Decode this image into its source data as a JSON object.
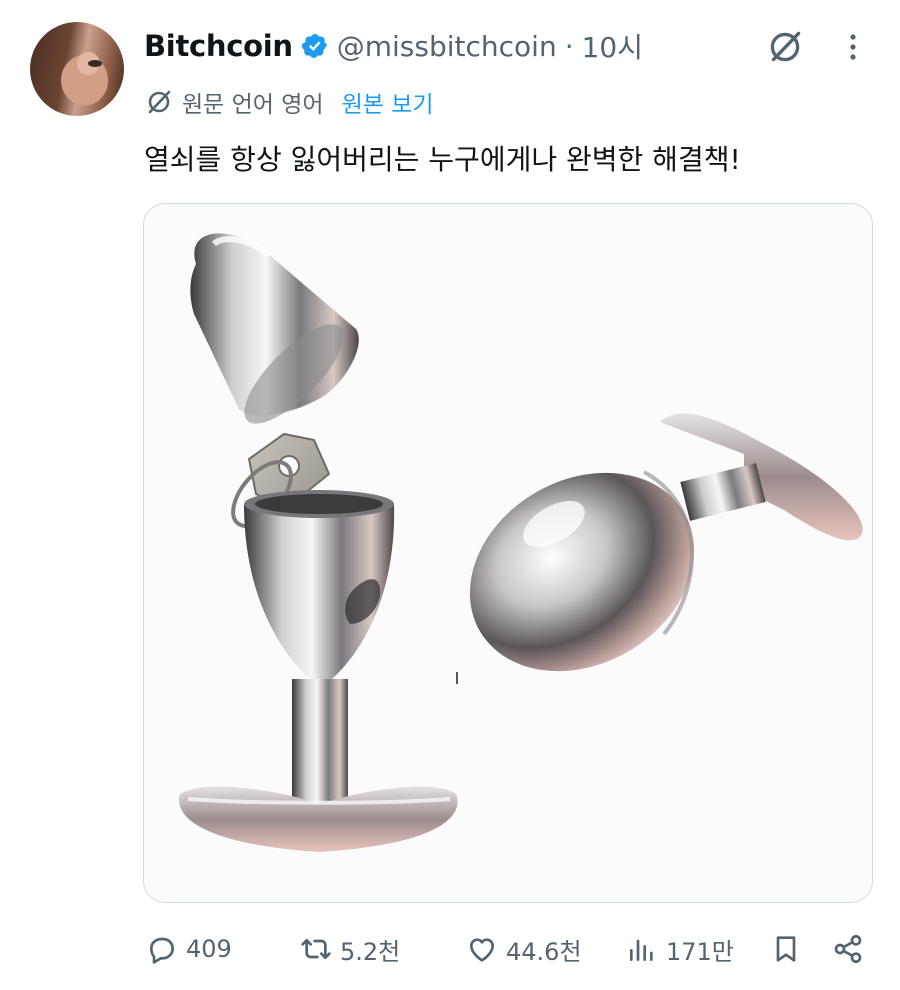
{
  "user": {
    "display_name": "Bitchcoin",
    "handle": "@missbitchcoin",
    "separator": "·",
    "time": "10시",
    "verified": true,
    "avatar_icon": "avatar-photo"
  },
  "translation": {
    "label": "원문 언어 영어",
    "link": "원본 보기",
    "icon": "translate-globe-icon"
  },
  "tweet": {
    "text": "열쇠를 항상 잃어버리는 누구에게나 완벽한 해결책!",
    "media_description_icon": "product-photo"
  },
  "header_actions": {
    "grok_icon": "grok-icon",
    "more_icon": "more-vertical-icon"
  },
  "actions": {
    "reply_count": "409",
    "repost_count": "5.2천",
    "like_count": "44.6천",
    "views_count": "171만"
  },
  "colors": {
    "text": "#0f1419",
    "secondary": "#536471",
    "link": "#1d9bf0",
    "verified": "#1d9bf0",
    "border": "#cfd9de"
  }
}
